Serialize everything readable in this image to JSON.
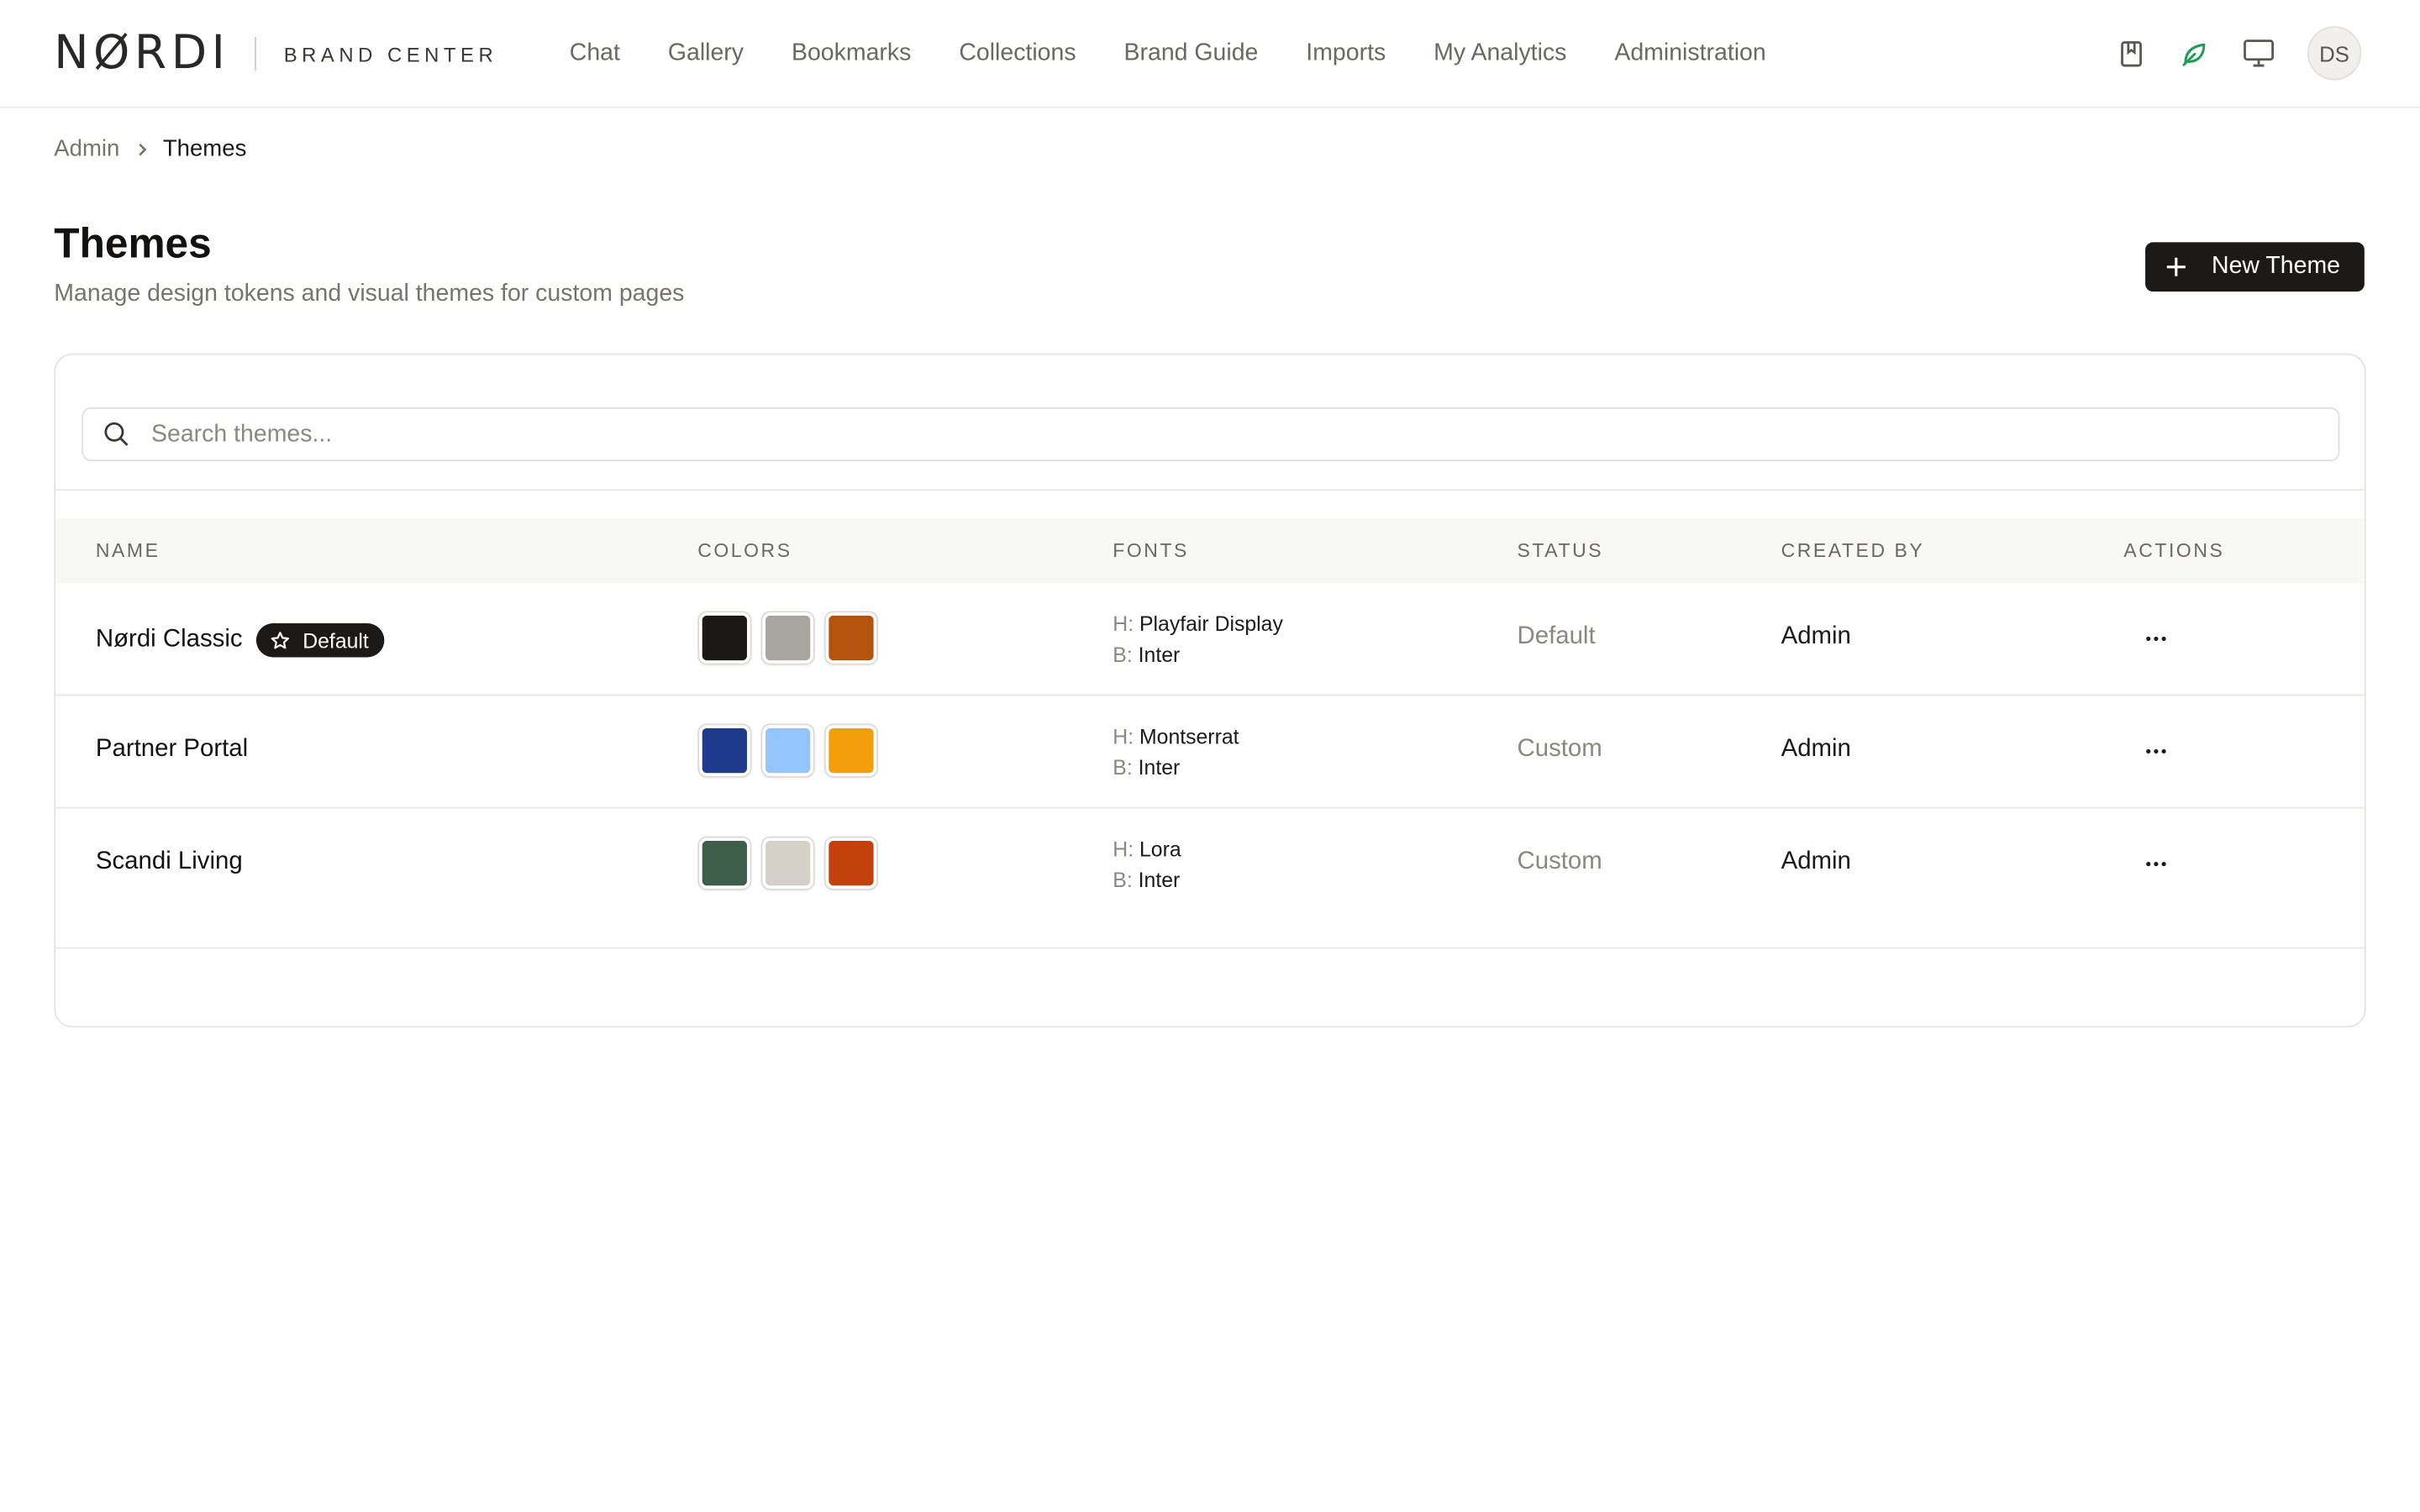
{
  "brand": {
    "logo": "NØRDI",
    "subtitle": "BRAND CENTER"
  },
  "nav": [
    {
      "label": "Chat"
    },
    {
      "label": "Gallery"
    },
    {
      "label": "Bookmarks"
    },
    {
      "label": "Collections"
    },
    {
      "label": "Brand Guide"
    },
    {
      "label": "Imports"
    },
    {
      "label": "My Analytics"
    },
    {
      "label": "Administration"
    }
  ],
  "header_icons": [
    "bookmark-icon",
    "leaf-icon",
    "monitor-icon"
  ],
  "user": {
    "initials": "DS"
  },
  "breadcrumb": {
    "parent": "Admin",
    "current": "Themes"
  },
  "page": {
    "title": "Themes",
    "subtitle": "Manage design tokens and visual themes for custom pages",
    "new_button": "New Theme"
  },
  "search": {
    "placeholder": "Search themes...",
    "value": ""
  },
  "table": {
    "columns": [
      "NAME",
      "COLORS",
      "FONTS",
      "STATUS",
      "CREATED BY",
      "ACTIONS"
    ],
    "rows": [
      {
        "name": "Nørdi Classic",
        "badge": "Default",
        "colors": [
          "#1b1917",
          "#a8a5a1",
          "#b5520d"
        ],
        "heading_prefix": "H:",
        "heading_font": "Playfair Display",
        "body_prefix": "B:",
        "body_font": "Inter",
        "status": "Default",
        "created_by": "Admin",
        "actions": "···"
      },
      {
        "name": "Partner Portal",
        "badge": "",
        "colors": [
          "#1e3a8a",
          "#93c5fd",
          "#f59e0b"
        ],
        "heading_prefix": "H:",
        "heading_font": "Montserrat",
        "body_prefix": "B:",
        "body_font": "Inter",
        "status": "Custom",
        "created_by": "Admin",
        "actions": "···"
      },
      {
        "name": "Scandi Living",
        "badge": "",
        "colors": [
          "#3f5e4a",
          "#d6d1c6",
          "#c2410c"
        ],
        "heading_prefix": "H:",
        "heading_font": "Lora",
        "body_prefix": "B:",
        "body_font": "Inter",
        "status": "Custom",
        "created_by": "Admin",
        "actions": "···"
      }
    ]
  },
  "colors": {
    "accent_dark": "#1c1a18",
    "leaf_green": "#1f9d55"
  }
}
